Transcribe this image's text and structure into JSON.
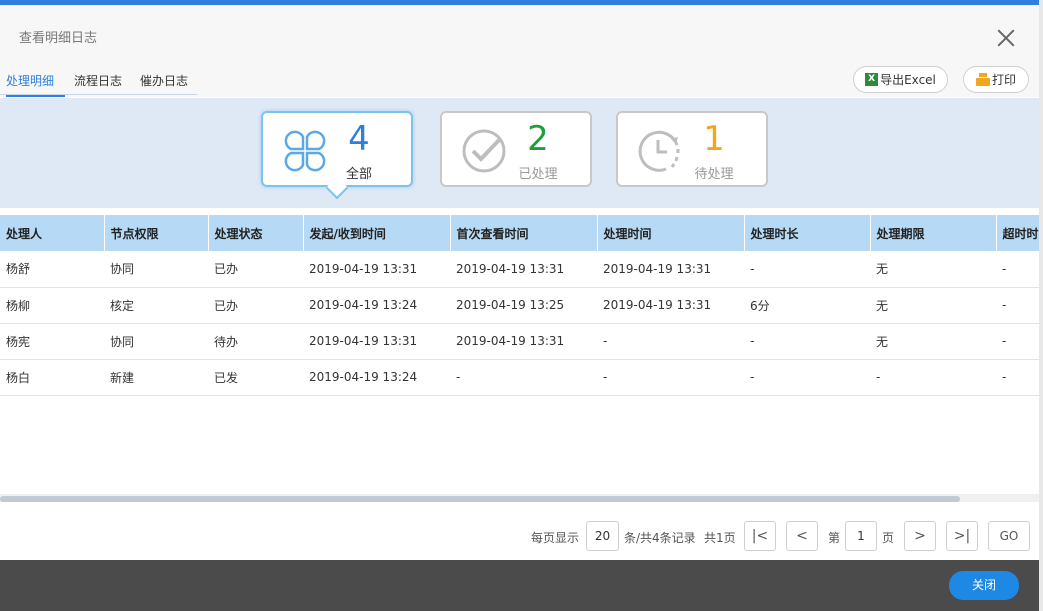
{
  "dialog": {
    "title": "查看明细日志"
  },
  "tabs": [
    {
      "label": "处理明细"
    },
    {
      "label": "流程日志"
    },
    {
      "label": "催办日志"
    }
  ],
  "toolbar": {
    "export_label": "导出Excel",
    "print_label": "打印",
    "xls_glyph": "X"
  },
  "summary": {
    "all": {
      "count": "4",
      "label": "全部",
      "color": "#2f80dc"
    },
    "done": {
      "count": "2",
      "label": "已处理",
      "color": "#1f9e3a"
    },
    "pending": {
      "count": "1",
      "label": "待处理",
      "color": "#f2a51e"
    }
  },
  "table": {
    "headers": [
      "处理人",
      "节点权限",
      "处理状态",
      "发起/收到时间",
      "首次查看时间",
      "处理时间",
      "处理时长",
      "处理期限",
      "超时时"
    ],
    "rows": [
      [
        "杨舒",
        "协同",
        "已办",
        "2019-04-19 13:31",
        "2019-04-19 13:31",
        "2019-04-19 13:31",
        "-",
        "无",
        "-"
      ],
      [
        "杨柳",
        "核定",
        "已办",
        "2019-04-19 13:24",
        "2019-04-19 13:25",
        "2019-04-19 13:31",
        "6分",
        "无",
        "-"
      ],
      [
        "杨宪",
        "协同",
        "待办",
        "2019-04-19 13:31",
        "2019-04-19 13:31",
        "-",
        "-",
        "无",
        "-"
      ],
      [
        "杨白",
        "新建",
        "已发",
        "2019-04-19 13:24",
        "-",
        "-",
        "-",
        "-",
        "-"
      ]
    ]
  },
  "pager": {
    "per_page_label": "每页显示",
    "per_page_value": "20",
    "records_label": "条/共4条记录",
    "pages_label": "共1页",
    "page_prefix": "第",
    "page_value": "1",
    "page_suffix": "页",
    "first_glyph": "|<",
    "prev_glyph": "<",
    "next_glyph": ">",
    "last_glyph": ">|",
    "go_label": "GO"
  },
  "footer": {
    "close_label": "关闭"
  }
}
